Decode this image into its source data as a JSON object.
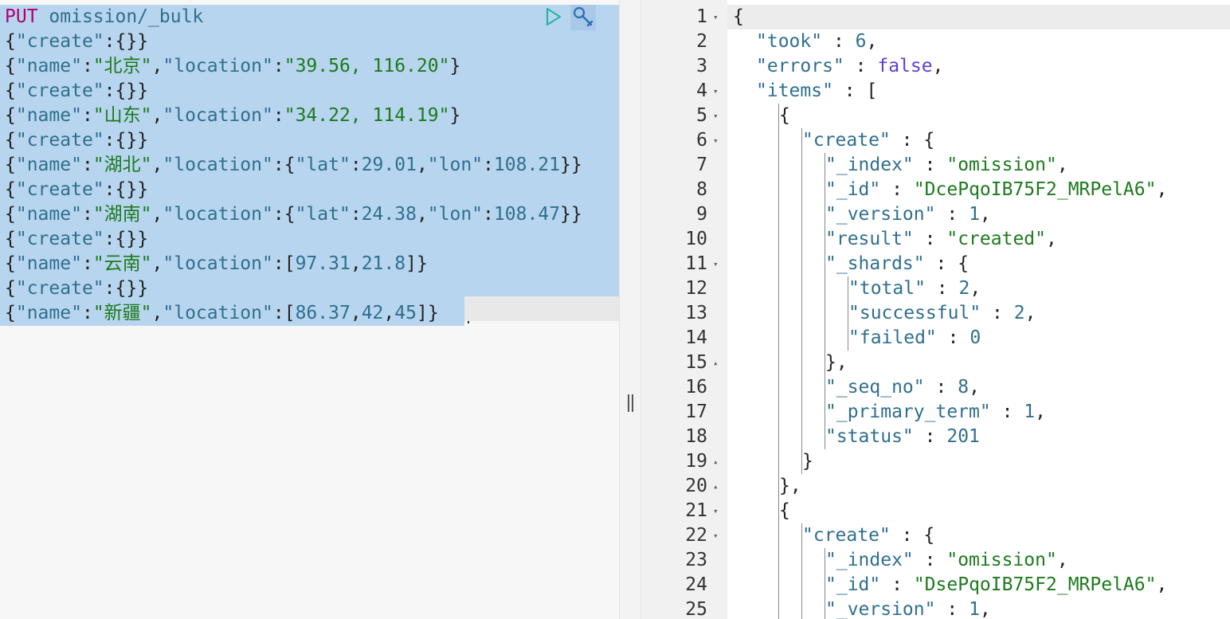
{
  "toolbar": {
    "run_icon": "play-triangle-icon",
    "settings_icon": "wrench-icon"
  },
  "request": {
    "method": "PUT",
    "path": "omission/_bulk",
    "lines": [
      "{\"create\":{}}",
      "{\"name\":\"北京\",\"location\":\"39.56, 116.20\"}",
      "{\"create\":{}}",
      "{\"name\":\"山东\",\"location\":\"34.22, 114.19\"}",
      "{\"create\":{}}",
      "{\"name\":\"湖北\",\"location\":{\"lat\":29.01,\"lon\":108.21}}",
      "{\"create\":{}}",
      "{\"name\":\"湖南\",\"location\":{\"lat\":24.38,\"lon\":108.47}}",
      "{\"create\":{}}",
      "{\"name\":\"云南\",\"location\":[97.31,21.8]}",
      "{\"create\":{}}",
      "{\"name\":\"新疆\",\"location\":[86.37,42,45]}"
    ]
  },
  "splitter": {
    "label": "||"
  },
  "response": {
    "lines": [
      {
        "n": "1",
        "fold": "▾",
        "code": "{",
        "indent": 0
      },
      {
        "n": "2",
        "fold": "",
        "code": "\"took\" : 6,",
        "indent": 1
      },
      {
        "n": "3",
        "fold": "",
        "code": "\"errors\" : false,",
        "indent": 1
      },
      {
        "n": "4",
        "fold": "▾",
        "code": "\"items\" : [",
        "indent": 1
      },
      {
        "n": "5",
        "fold": "▾",
        "code": "{",
        "indent": 2
      },
      {
        "n": "6",
        "fold": "▾",
        "code": "\"create\" : {",
        "indent": 3
      },
      {
        "n": "7",
        "fold": "",
        "code": "\"_index\" : \"omission\",",
        "indent": 4
      },
      {
        "n": "8",
        "fold": "",
        "code": "\"_id\" : \"DcePqoIB75F2_MRPelA6\",",
        "indent": 4
      },
      {
        "n": "9",
        "fold": "",
        "code": "\"_version\" : 1,",
        "indent": 4
      },
      {
        "n": "10",
        "fold": "",
        "code": "\"result\" : \"created\",",
        "indent": 4
      },
      {
        "n": "11",
        "fold": "▾",
        "code": "\"_shards\" : {",
        "indent": 4
      },
      {
        "n": "12",
        "fold": "",
        "code": "\"total\" : 2,",
        "indent": 5
      },
      {
        "n": "13",
        "fold": "",
        "code": "\"successful\" : 2,",
        "indent": 5
      },
      {
        "n": "14",
        "fold": "",
        "code": "\"failed\" : 0",
        "indent": 5
      },
      {
        "n": "15",
        "fold": "▴",
        "code": "},",
        "indent": 4
      },
      {
        "n": "16",
        "fold": "",
        "code": "\"_seq_no\" : 8,",
        "indent": 4
      },
      {
        "n": "17",
        "fold": "",
        "code": "\"_primary_term\" : 1,",
        "indent": 4
      },
      {
        "n": "18",
        "fold": "",
        "code": "\"status\" : 201",
        "indent": 4
      },
      {
        "n": "19",
        "fold": "▴",
        "code": "}",
        "indent": 3
      },
      {
        "n": "20",
        "fold": "▴",
        "code": "},",
        "indent": 2
      },
      {
        "n": "21",
        "fold": "▾",
        "code": "{",
        "indent": 2
      },
      {
        "n": "22",
        "fold": "▾",
        "code": "\"create\" : {",
        "indent": 3
      },
      {
        "n": "23",
        "fold": "",
        "code": "\"_index\" : \"omission\",",
        "indent": 4
      },
      {
        "n": "24",
        "fold": "",
        "code": "\"_id\" : \"DsePqoIB75F2_MRPelA6\",",
        "indent": 4
      },
      {
        "n": "25",
        "fold": "",
        "code": "\"_version\" : 1,",
        "indent": 4
      }
    ]
  },
  "colors": {
    "selection": "#b7d5ee",
    "method": "#b0006e",
    "key": "#2f6f8f",
    "string": "#1d7a1d",
    "boolean": "#5b3fd6"
  }
}
